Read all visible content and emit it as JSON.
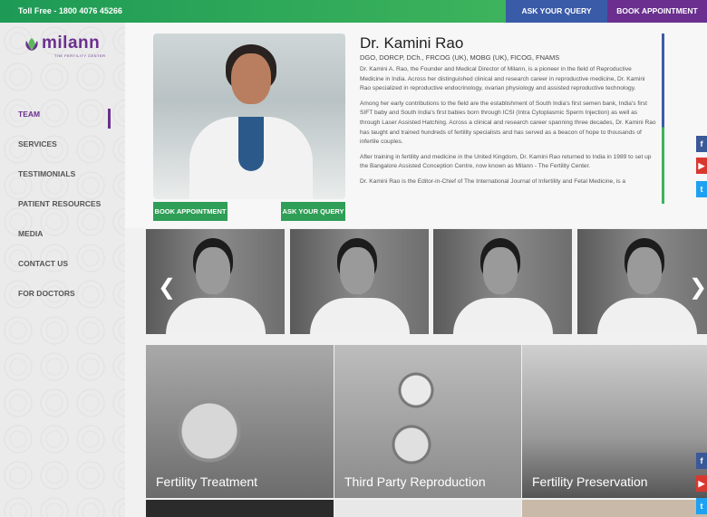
{
  "topbar": {
    "toll_free": "Toll Free - 1800 4076 45266",
    "ask_query": "ASK YOUR QUERY",
    "book_appointment": "BOOK APPOINTMENT"
  },
  "logo": {
    "name": "milann",
    "tagline": "THE FERTILITY CENTER"
  },
  "nav": {
    "items": [
      {
        "label": "TEAM",
        "active": true
      },
      {
        "label": "SERVICES",
        "active": false
      },
      {
        "label": "TESTIMONIALS",
        "active": false
      },
      {
        "label": "PATIENT RESOURCES",
        "active": false
      },
      {
        "label": "MEDIA",
        "active": false
      },
      {
        "label": "CONTACT US",
        "active": false
      },
      {
        "label": "FOR DOCTORS",
        "active": false
      }
    ]
  },
  "profile": {
    "name": "Dr. Kamini Rao",
    "credentials": "DGO, DORCP, DCh., FRCOG (UK), MOBG (UK), FICOG, FNAMS",
    "bio": [
      "Dr. Kamini A. Rao, the Founder and Medical Director of Milann, is a pioneer in the field of Reproductive Medicine in India. Across her distinguished clinical and research career in reproductive medicine, Dr. Kamini Rao specialized in reproductive endocrinology, ovarian physiology and assisted reproductive technology.",
      "Among her early contributions to the field are the establishment of South India's first semen bank, India's first SIFT baby and South India's first babies born through ICSI (Intra Cytoplasmic Sperm Injection) as well as through Laser Assisted Hatching. Across a clinical and research career spanning three decades, Dr. Kamini Rao has taught and trained hundreds of fertility specialists and has served as a beacon of hope to thousands of infertile couples.",
      "After training in fertility and medicine in the United Kingdom, Dr. Kamini Rao returned to India in 1989 to set up the Bangalore Assisted Conception Centre, now known as Milann - The Fertility Center.",
      "Dr. Kamini Rao is the Editor-in-Chief of The International Journal of Infertility and Fetal Medicine, is a"
    ],
    "book_appointment": "BOOK APPOINTMENT",
    "ask_query": "ASK YOUR QUERY"
  },
  "services": [
    {
      "label": "Fertility Treatment"
    },
    {
      "label": "Third Party Reproduction"
    },
    {
      "label": "Fertility Preservation"
    }
  ],
  "social": {
    "facebook": "f",
    "youtube": "▶",
    "twitter": "t"
  }
}
